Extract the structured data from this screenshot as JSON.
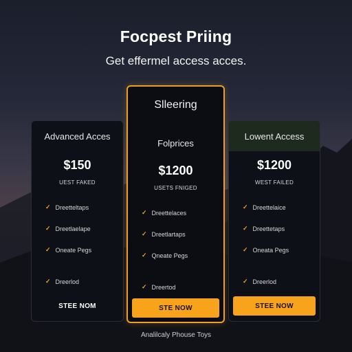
{
  "header": {
    "title": "Focpest Priing",
    "subtitle": "Get effermel access acces."
  },
  "plans": [
    {
      "name": "Advanced Acces",
      "price": "$150",
      "note": "UEST FAKED",
      "features": [
        "Dreetteltaps",
        "Dreetlaelape",
        "Oneate Pegs",
        "Dreerlod"
      ],
      "cta": "STEE NOM"
    },
    {
      "featured_label": "Slleering",
      "name": "Folprices",
      "price": "$1200",
      "note": "USETS FNIGED",
      "features": [
        "Dreettelaces",
        "Dreetlartaps",
        "Qneate Pegs",
        "Dreertod"
      ],
      "cta": "STE NOW"
    },
    {
      "name": "Lowent Access",
      "price": "$1200",
      "note": "WEST FAILED",
      "features": [
        "Dreettelaice",
        "Dreettetaps",
        "Oneata Pegs",
        "Dreerlod"
      ],
      "cta": "STEE NOW"
    }
  ],
  "footer": {
    "text": "Analilcaly Phouse Toys"
  },
  "colors": {
    "accent": "#f8a31c",
    "card_bg": "#0d1016",
    "check": "#f0a020"
  }
}
